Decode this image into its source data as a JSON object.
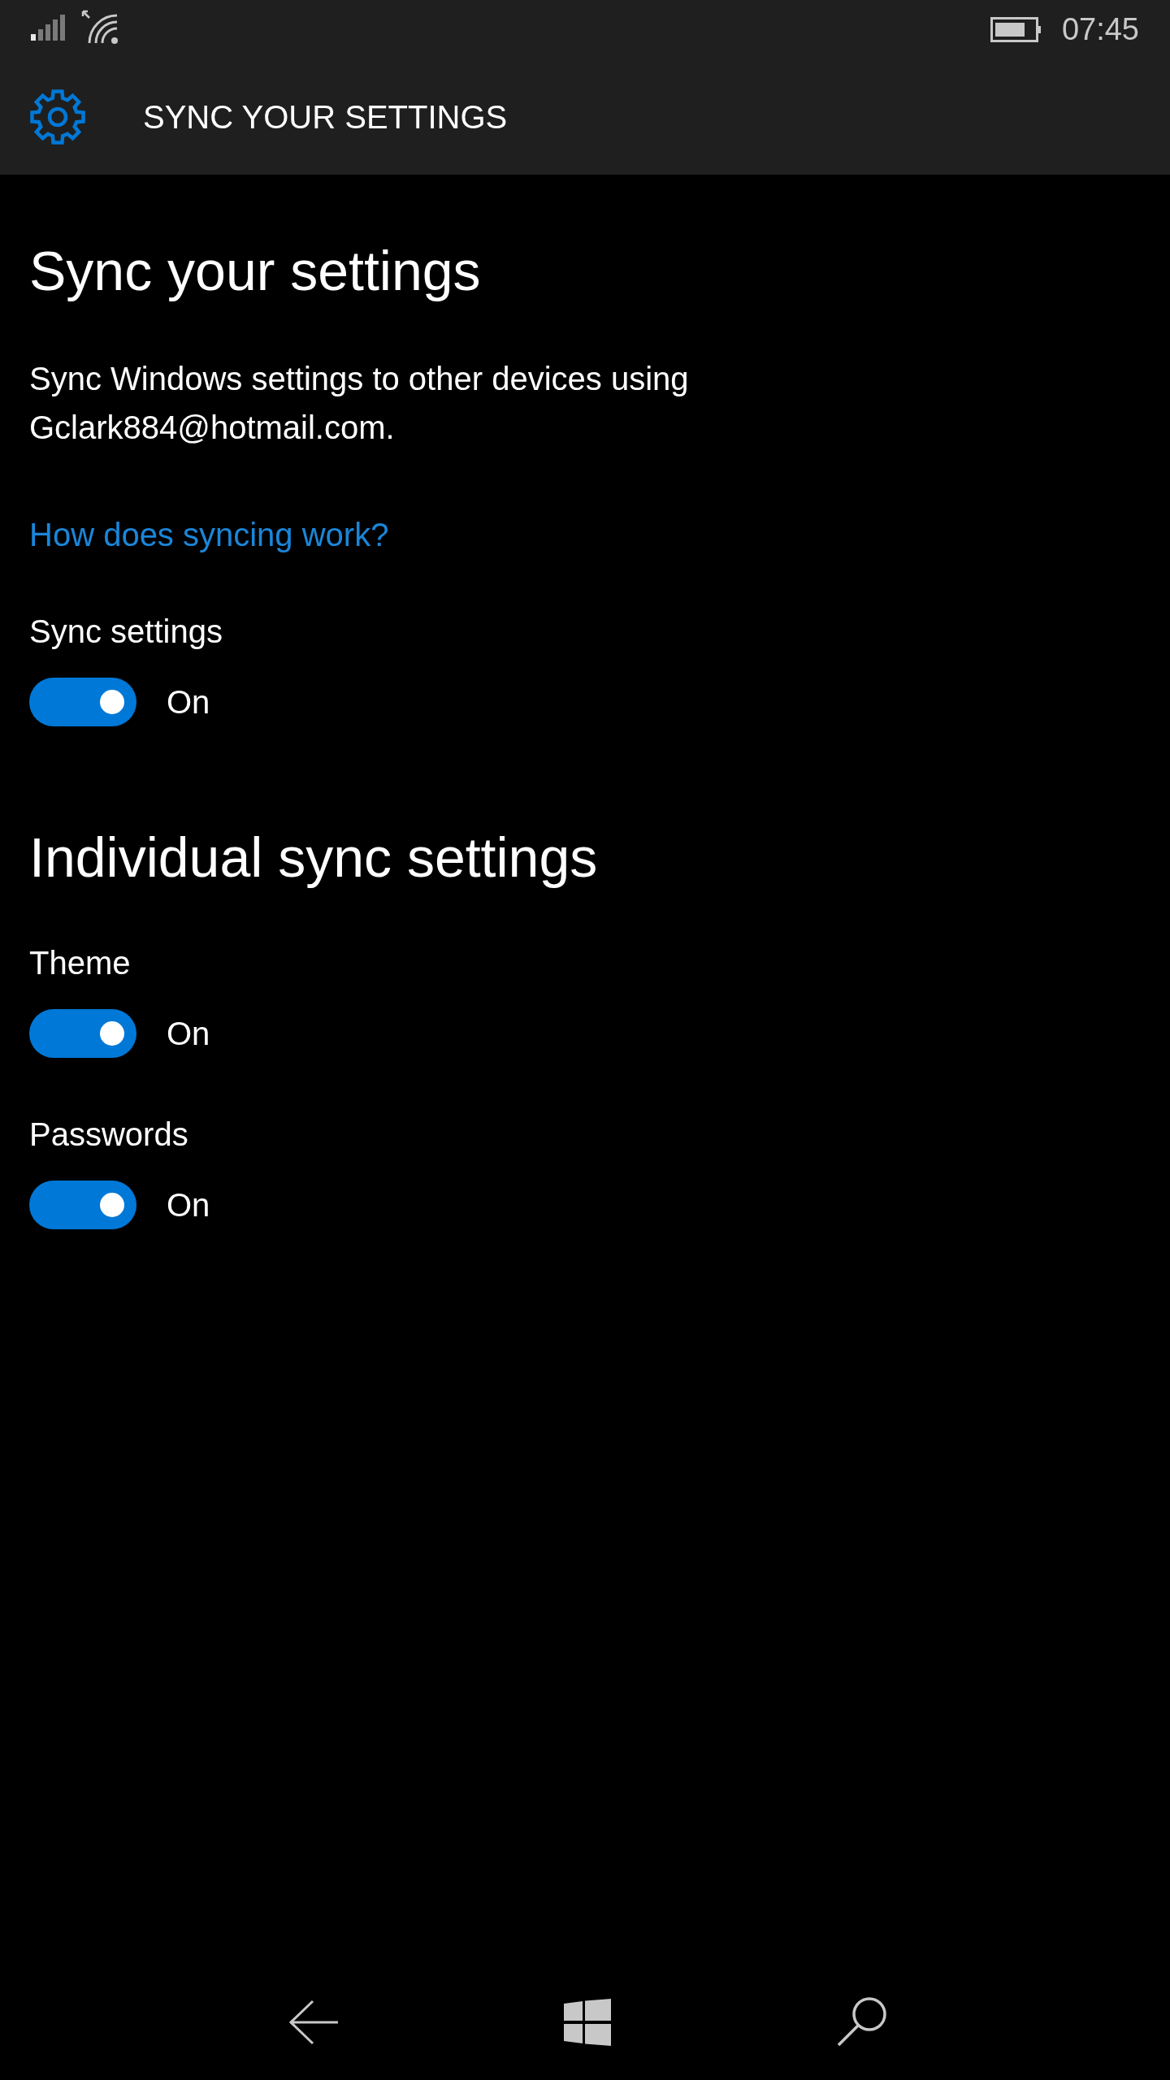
{
  "status_bar": {
    "time": "07:45"
  },
  "header": {
    "title": "SYNC YOUR SETTINGS"
  },
  "page": {
    "title": "Sync your settings",
    "description": "Sync Windows settings to other devices using Gclark884@hotmail.com.",
    "link": "How does syncing work?"
  },
  "sync_settings": {
    "label": "Sync settings",
    "on": true,
    "state_text": "On"
  },
  "individual": {
    "title": "Individual sync settings",
    "items": [
      {
        "label": "Theme",
        "on": true,
        "state_text": "On"
      },
      {
        "label": "Passwords",
        "on": true,
        "state_text": "On"
      }
    ]
  }
}
